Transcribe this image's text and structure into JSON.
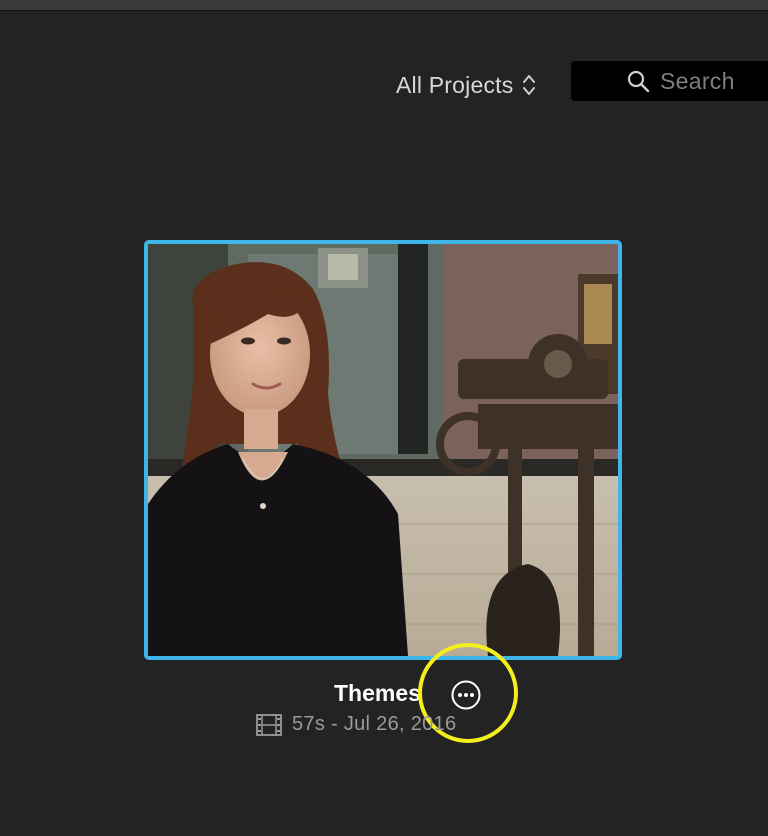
{
  "toolbar": {
    "sort_label": "All Projects",
    "sort_icon": "up-down-chevron-icon",
    "search_placeholder": "Search",
    "search_icon": "search-icon"
  },
  "project": {
    "title": "Themes",
    "duration": "57s",
    "separator": "-",
    "date": "Jul 26, 2016",
    "meta_text": "57s - Jul 26, 2016",
    "selected": true,
    "thumbnail_icon": "video-thumbnail",
    "more_icon": "ellipsis-circle-icon",
    "media_icon": "film-strip-icon"
  },
  "colors": {
    "background": "#232323",
    "selection_border": "#3fb6ea",
    "highlight_ring": "#f2ef1c",
    "title_text": "#ffffff",
    "meta_text": "#9a9a9a"
  }
}
